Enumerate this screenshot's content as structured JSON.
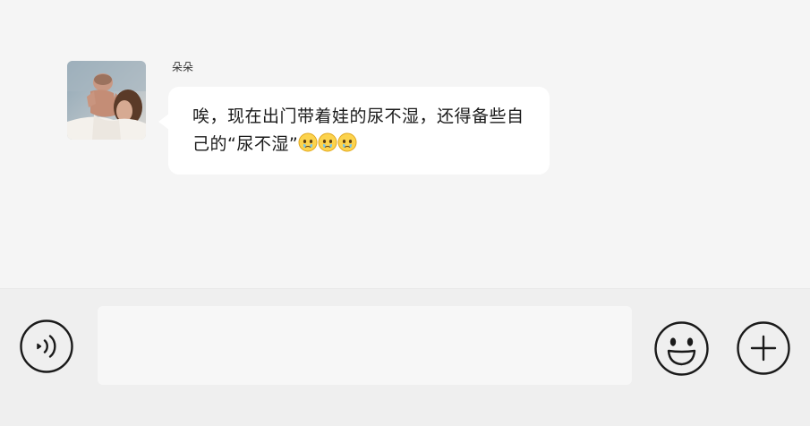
{
  "message": {
    "sender": "朵朵",
    "text": "唉，现在出门带着娃的尿不湿，还得备些自己的“尿不湿”",
    "emojis": [
      "crying-face-emoji",
      "crying-face-emoji",
      "crying-face-emoji"
    ]
  },
  "input_bar": {
    "text_value": "",
    "icons": [
      "voice-icon",
      "emoji-face-icon",
      "plus-icon"
    ]
  },
  "colors": {
    "chat_background": "#f5f5f5",
    "bubble_background": "#ffffff",
    "input_bar_background": "#efefef",
    "icon_stroke": "#1a1a1a"
  }
}
